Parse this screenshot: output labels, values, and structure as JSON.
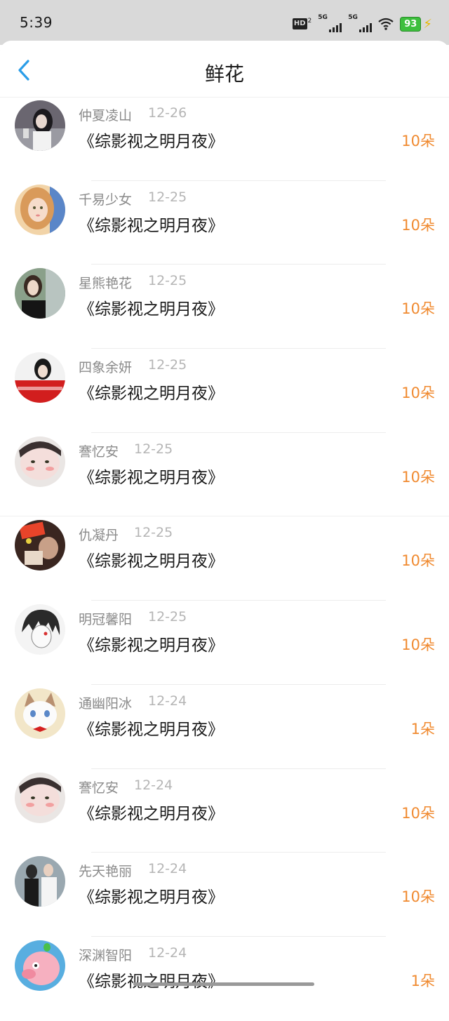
{
  "status": {
    "time": "5:39",
    "hd_label": "HD",
    "hd_sup": "2",
    "net1": "5G",
    "net2": "5G",
    "battery": "93",
    "icons": [
      "hd-icon",
      "signal-icon",
      "signal-icon",
      "wifi-icon",
      "battery-icon",
      "charging-icon"
    ]
  },
  "header": {
    "title": "鲜花",
    "back_icon": "back-chevron-icon"
  },
  "colors": {
    "accent": "#2a9de8",
    "amount": "#f08a30"
  },
  "records": [
    {
      "name": "仲夏凌山",
      "date": "12-26",
      "work": "《综影视之明月夜》",
      "amount": "10朵",
      "avatar": "avatar-girl-dark-hair"
    },
    {
      "name": "千易少女",
      "date": "12-25",
      "work": "《综影视之明月夜》",
      "amount": "10朵",
      "avatar": "avatar-girl-blonde"
    },
    {
      "name": "星熊艳花",
      "date": "12-25",
      "work": "《综影视之明月夜》",
      "amount": "10朵",
      "avatar": "avatar-woman-portrait"
    },
    {
      "name": "四象余妍",
      "date": "12-25",
      "work": "《综影视之明月夜》",
      "amount": "10朵",
      "avatar": "avatar-red-dress"
    },
    {
      "name": "謇忆安",
      "date": "12-25",
      "work": "《综影视之明月夜》",
      "amount": "10朵",
      "avatar": "avatar-face-closeup"
    },
    {
      "name": "仇凝丹",
      "date": "12-25",
      "work": "《综影视之明月夜》",
      "amount": "10朵",
      "avatar": "avatar-birthday"
    },
    {
      "name": "明冠馨阳",
      "date": "12-25",
      "work": "《综影视之明月夜》",
      "amount": "10朵",
      "avatar": "avatar-anime-sketch"
    },
    {
      "name": "通幽阳冰",
      "date": "12-24",
      "work": "《综影视之明月夜》",
      "amount": "1朵",
      "avatar": "avatar-cat"
    },
    {
      "name": "謇忆安",
      "date": "12-24",
      "work": "《综影视之明月夜》",
      "amount": "10朵",
      "avatar": "avatar-face-closeup"
    },
    {
      "name": "先天艳丽",
      "date": "12-24",
      "work": "《综影视之明月夜》",
      "amount": "10朵",
      "avatar": "avatar-couple"
    },
    {
      "name": "深渊智阳",
      "date": "12-24",
      "work": "《综影视之明月夜》",
      "amount": "1朵",
      "avatar": "avatar-cartoon-pink"
    }
  ]
}
